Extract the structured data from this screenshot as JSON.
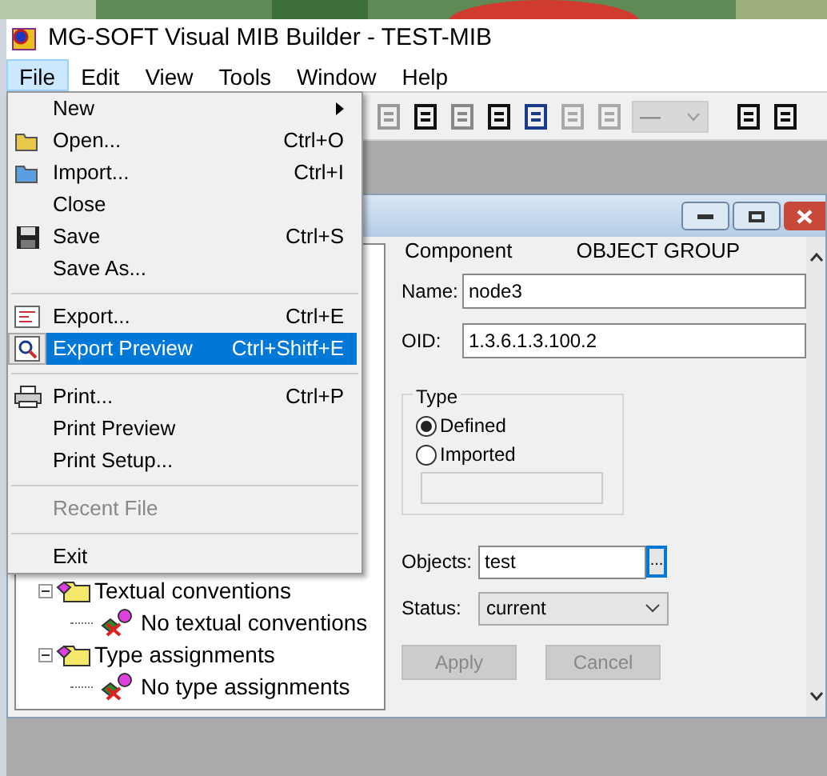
{
  "window": {
    "title": "MG-SOFT Visual MIB Builder - TEST-MIB"
  },
  "menu_bar": [
    {
      "label": "File",
      "selected": true
    },
    {
      "label": "Edit",
      "selected": false
    },
    {
      "label": "View",
      "selected": false
    },
    {
      "label": "Tools",
      "selected": false
    },
    {
      "label": "Window",
      "selected": false
    },
    {
      "label": "Help",
      "selected": false
    }
  ],
  "file_menu": [
    {
      "kind": "item",
      "label": "New",
      "submenu": true,
      "selected": false,
      "disabled": false
    },
    {
      "kind": "item",
      "label": "Open...",
      "shortcut": "Ctrl+O",
      "submenu": false,
      "selected": false,
      "disabled": false
    },
    {
      "kind": "item",
      "label": "Import...",
      "shortcut": "Ctrl+I",
      "submenu": false,
      "selected": false,
      "disabled": false
    },
    {
      "kind": "item",
      "label": "Close",
      "submenu": false,
      "selected": false,
      "disabled": false
    },
    {
      "kind": "item",
      "label": "Save",
      "shortcut": "Ctrl+S",
      "submenu": false,
      "selected": false,
      "disabled": false
    },
    {
      "kind": "item",
      "label": "Save As...",
      "submenu": false,
      "selected": false,
      "disabled": false
    },
    {
      "kind": "separator"
    },
    {
      "kind": "item",
      "label": "Export...",
      "shortcut": "Ctrl+E",
      "submenu": false,
      "selected": false,
      "disabled": false
    },
    {
      "kind": "item",
      "label": "Export Preview",
      "shortcut": "Ctrl+Shitf+E",
      "submenu": false,
      "selected": true,
      "disabled": false
    },
    {
      "kind": "separator"
    },
    {
      "kind": "item",
      "label": "Print...",
      "shortcut": "Ctrl+P",
      "submenu": false,
      "selected": false,
      "disabled": false
    },
    {
      "kind": "item",
      "label": "Print Preview",
      "submenu": false,
      "selected": false,
      "disabled": false
    },
    {
      "kind": "item",
      "label": "Print Setup...",
      "submenu": false,
      "selected": false,
      "disabled": false
    },
    {
      "kind": "separator"
    },
    {
      "kind": "item",
      "label": "Recent File",
      "submenu": false,
      "selected": false,
      "disabled": true
    },
    {
      "kind": "separator"
    },
    {
      "kind": "item",
      "label": "Exit",
      "submenu": false,
      "selected": false,
      "disabled": false
    }
  ],
  "toolbar_combo": {
    "value": "—",
    "disabled": true
  },
  "tree": [
    {
      "label": "Textual conventions",
      "expanded": true,
      "children": [
        {
          "label": "No textual conventions"
        }
      ]
    },
    {
      "label": "Type assignments",
      "expanded": true,
      "children": [
        {
          "label": "No type assignments"
        }
      ]
    }
  ],
  "details": {
    "component_label": "Component",
    "component_value": "OBJECT GROUP",
    "name_label": "Name:",
    "name": "node3",
    "oid_label": "OID:",
    "oid": "1.3.6.1.3.100.2",
    "type_title": "Type",
    "type_options": [
      {
        "label": "Defined",
        "selected": true
      },
      {
        "label": "Imported",
        "selected": false
      }
    ],
    "objects_label": "Objects:",
    "objects": "test",
    "browse_button": "...",
    "status_label": "Status:",
    "status": "current",
    "buttons": [
      {
        "label": "Apply",
        "disabled": true
      },
      {
        "label": "Cancel",
        "disabled": true
      }
    ]
  }
}
